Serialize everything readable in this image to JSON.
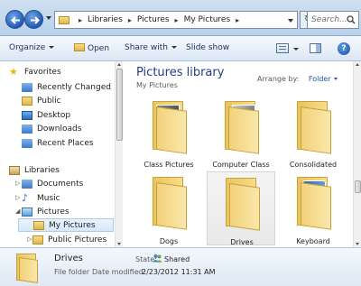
{
  "address": {
    "breadcrumbs": [
      "Libraries",
      "Pictures",
      "My Pictures"
    ],
    "search_placeholder": "Search..."
  },
  "toolbar": {
    "organize": "Organize",
    "open": "Open",
    "share_with": "Share with",
    "slide_show": "Slide show",
    "help": "?"
  },
  "nav": {
    "items": [
      {
        "label": "Favorites",
        "icon": "star-icon"
      },
      {
        "label": "Recently Changed",
        "icon": "recent-icon"
      },
      {
        "label": "Public",
        "icon": "folder-icon"
      },
      {
        "label": "Desktop",
        "icon": "desktop-icon"
      },
      {
        "label": "Downloads",
        "icon": "downloads-icon"
      },
      {
        "label": "Recent Places",
        "icon": "recent-places-icon"
      },
      {
        "label": "Libraries",
        "icon": "libraries-icon"
      },
      {
        "label": "Documents",
        "icon": "documents-icon"
      },
      {
        "label": "Music",
        "icon": "music-icon"
      },
      {
        "label": "Pictures",
        "icon": "pictures-icon"
      },
      {
        "label": "My Pictures",
        "icon": "folder-icon"
      },
      {
        "label": "Public Pictures",
        "icon": "folder-icon"
      }
    ]
  },
  "content": {
    "title": "Pictures library",
    "subtitle": "My Pictures",
    "arrange_label": "Arrange by:",
    "arrange_value": "Folder",
    "items": [
      {
        "name": "Class Pictures"
      },
      {
        "name": "Computer Class"
      },
      {
        "name": "Consolidated"
      },
      {
        "name": "Dogs"
      },
      {
        "name": "Drives"
      },
      {
        "name": "Keyboard"
      }
    ]
  },
  "details": {
    "name": "Drives",
    "type": "File folder",
    "state_label": "State:",
    "state_value": "Shared",
    "modified_label": "Date modified:",
    "modified_value": "2/23/2012 11:31 AM"
  }
}
